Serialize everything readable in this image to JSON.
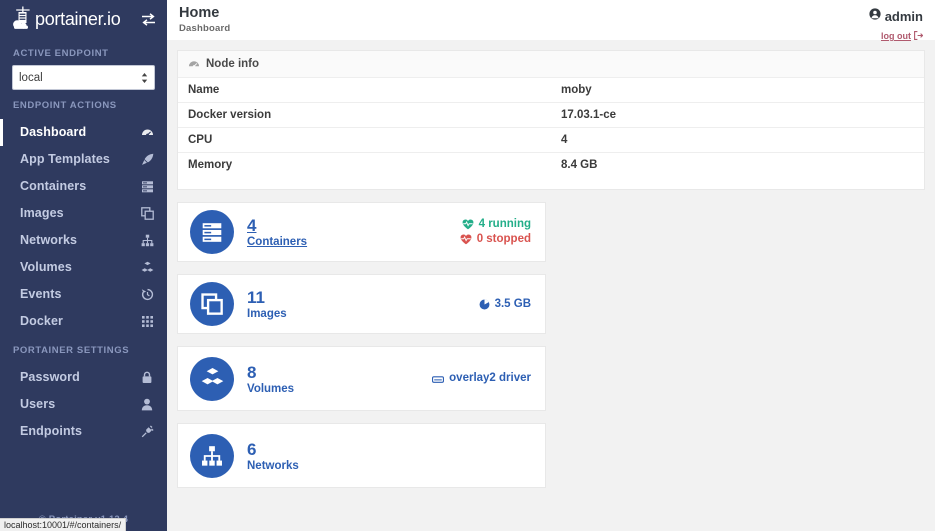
{
  "sidebar": {
    "brand": "portainer.io",
    "brand_icon": "portainer-whale-logo",
    "toggle_icon": "exchange-arrows-icon",
    "sections": [
      {
        "heading": "ACTIVE ENDPOINT"
      },
      {
        "heading": "ENDPOINT ACTIONS"
      },
      {
        "heading": "PORTAINER SETTINGS"
      }
    ],
    "endpoint_select": {
      "value": "local",
      "options": [
        "local"
      ]
    },
    "endpoint_actions": [
      {
        "label": "Dashboard",
        "icon": "tachometer-icon",
        "active": true
      },
      {
        "label": "App Templates",
        "icon": "rocket-icon",
        "active": false
      },
      {
        "label": "Containers",
        "icon": "server-icon",
        "active": false
      },
      {
        "label": "Images",
        "icon": "clone-icon",
        "active": false
      },
      {
        "label": "Networks",
        "icon": "sitemap-icon",
        "active": false
      },
      {
        "label": "Volumes",
        "icon": "cubes-icon",
        "active": false
      },
      {
        "label": "Events",
        "icon": "history-icon",
        "active": false
      },
      {
        "label": "Docker",
        "icon": "th-grid-icon",
        "active": false
      }
    ],
    "portainer_settings": [
      {
        "label": "Password",
        "icon": "lock-icon"
      },
      {
        "label": "Users",
        "icon": "user-icon"
      },
      {
        "label": "Endpoints",
        "icon": "plug-icon"
      }
    ],
    "footer": "© Portainer v1.12.4"
  },
  "header": {
    "title": "Home",
    "subtitle": "Dashboard",
    "user_icon": "user-circle-icon",
    "username": "admin",
    "logout_label": "log out",
    "logout_icon": "sign-out-icon"
  },
  "node_info": {
    "panel_icon": "tachometer-icon",
    "panel_title": "Node info",
    "rows": [
      {
        "key": "Name",
        "value": "moby"
      },
      {
        "key": "Docker version",
        "value": "17.03.1-ce"
      },
      {
        "key": "CPU",
        "value": "4"
      },
      {
        "key": "Memory",
        "value": "8.4 GB"
      }
    ]
  },
  "cards": [
    {
      "icon": "server-icon",
      "count": "4",
      "label": "Containers",
      "stats": [
        {
          "icon": "heartbeat-green-icon",
          "text": "4 running",
          "color": "#23ae89"
        },
        {
          "icon": "heartbeat-red-icon",
          "text": "0 stopped",
          "color": "#d9534f"
        }
      ]
    },
    {
      "icon": "clone-icon",
      "count": "11",
      "label": "Images",
      "stats": [
        {
          "icon": "pie-chart-icon",
          "text": "3.5 GB",
          "color": "#2d5fb3"
        }
      ]
    },
    {
      "icon": "cubes-icon",
      "count": "8",
      "label": "Volumes",
      "stats": [
        {
          "icon": "hdd-icon",
          "text": "overlay2 driver",
          "color": "#2d5fb3"
        }
      ]
    },
    {
      "icon": "sitemap-icon",
      "count": "6",
      "label": "Networks",
      "stats": []
    }
  ],
  "statusbar": {
    "url": "localhost:10001/#/containers/"
  },
  "colors": {
    "sidebar_bg": "#2f3a5f",
    "accent_blue": "#2d5fb3",
    "page_bg": "#f2f2f2",
    "running_green": "#23ae89",
    "stopped_red": "#d9534f",
    "logout_red": "#b05a6e"
  }
}
